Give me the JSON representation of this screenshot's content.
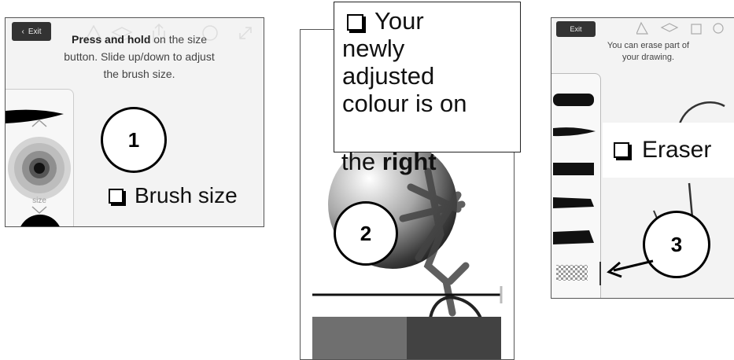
{
  "panel1": {
    "exit_label": "Exit",
    "hint_bold": "Press and hold",
    "hint_rest_1": " on the size",
    "hint_line_2": "button. Slide up/down to adjust",
    "hint_line_3": "the brush size.",
    "size_label": "size",
    "step_number": "1",
    "callout_label": "Brush size"
  },
  "panel2": {
    "callout_line_1": "Your",
    "callout_line_2": "newly",
    "callout_line_3": "adjusted",
    "callout_line_4": "colour is on",
    "callout_line_5_pre": "the ",
    "callout_line_5_bold": "right",
    "step_number": "2"
  },
  "panel3": {
    "exit_label": "Exit",
    "hint_line_1": "You can erase part of",
    "hint_line_2": "your drawing.",
    "step_number": "3",
    "callout_label": "Eraser"
  }
}
